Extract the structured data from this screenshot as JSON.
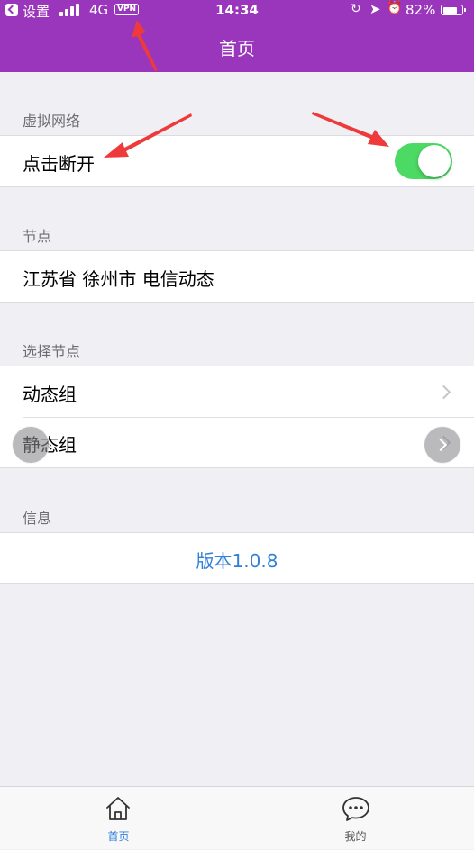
{
  "status_bar": {
    "back_label": "设置",
    "network": "4G",
    "vpn_badge": "VPN",
    "time": "14:34",
    "battery": "82%",
    "battery_level": 0.82
  },
  "nav": {
    "title": "首页"
  },
  "sections": {
    "vpn": {
      "header": "虚拟网络",
      "toggle_label": "点击断开",
      "toggle_on": true
    },
    "node": {
      "header": "节点",
      "current_node": "江苏省 徐州市 电信动态"
    },
    "select_node": {
      "header": "选择节点",
      "items": [
        {
          "label": "动态组"
        },
        {
          "label": "静态组"
        }
      ]
    },
    "info": {
      "header": "信息",
      "version": "版本1.0.8"
    }
  },
  "tab_bar": {
    "tabs": [
      {
        "label": "首页",
        "icon": "home-icon",
        "active": true
      },
      {
        "label": "我的",
        "icon": "chat-icon",
        "active": false
      }
    ]
  },
  "colors": {
    "header": "#9a36bb",
    "toggle_on": "#4cd964",
    "link": "#2f7fd8",
    "annotation_arrow": "#ee3a3a"
  }
}
